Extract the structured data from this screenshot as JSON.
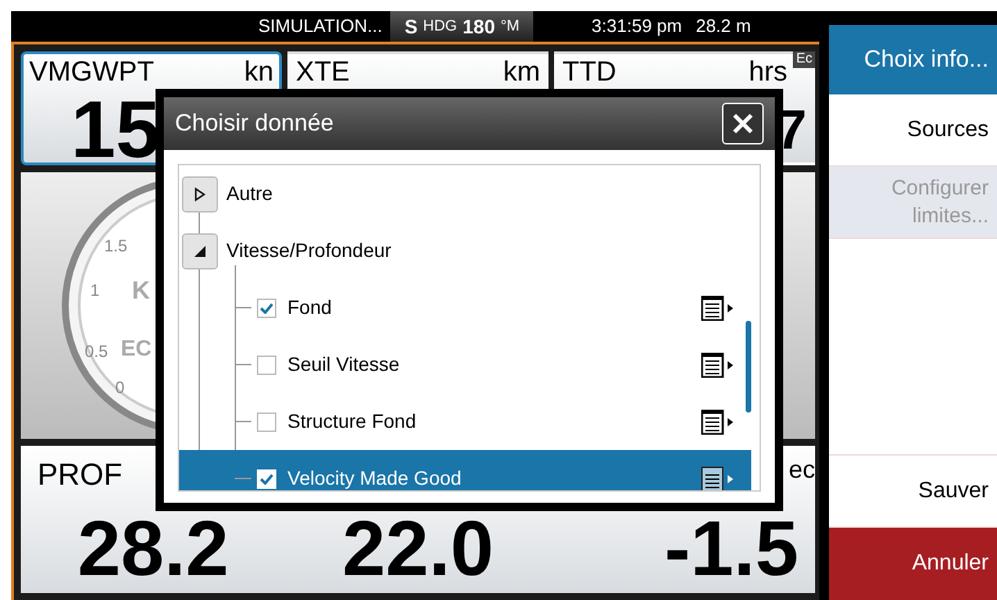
{
  "status_bar": {
    "mode": "SIMULATION...",
    "heading_prefix": "S",
    "heading_label": "HDG",
    "heading_value": "180",
    "heading_unit": "°M",
    "time": "3:31:59 pm",
    "depth": "28.2 m"
  },
  "top_cells": [
    {
      "label": "VMGWPT",
      "unit": "kn",
      "value": "15",
      "selected": true
    },
    {
      "label": "XTE",
      "unit": "km",
      "selected": false
    },
    {
      "label": "TTD",
      "unit": "hrs",
      "value": "7",
      "selected": false
    }
  ],
  "corner_badge": "Ec",
  "gauge": {
    "ticks": [
      "1.5",
      "1",
      "0.5",
      "0"
    ],
    "unit_text": "K",
    "label": "EC"
  },
  "bottom_cells": [
    {
      "label": "PROF",
      "value": "28.2"
    },
    {
      "value": "22.0"
    },
    {
      "label": "ec",
      "value": "-1.5"
    }
  ],
  "dialog": {
    "title": "Choisir donnée",
    "tree": [
      {
        "label": "Autre",
        "expanded": false
      },
      {
        "label": "Vitesse/Profondeur",
        "expanded": true,
        "children": [
          {
            "label": "Fond",
            "checked": true,
            "selected": false
          },
          {
            "label": "Seuil Vitesse",
            "checked": false,
            "selected": false
          },
          {
            "label": "Structure Fond",
            "checked": false,
            "selected": false
          },
          {
            "label": "Velocity Made Good",
            "checked": true,
            "selected": true
          }
        ]
      }
    ]
  },
  "side_menu": [
    {
      "kind": "header",
      "label": "Choix info..."
    },
    {
      "kind": "item",
      "label": "Sources",
      "disabled": false
    },
    {
      "kind": "item",
      "label": "Configurer limites...",
      "disabled": true
    },
    {
      "kind": "spacer"
    },
    {
      "kind": "item",
      "label": "Sauver",
      "disabled": false
    },
    {
      "kind": "cancel",
      "label": "Annuler"
    }
  ]
}
